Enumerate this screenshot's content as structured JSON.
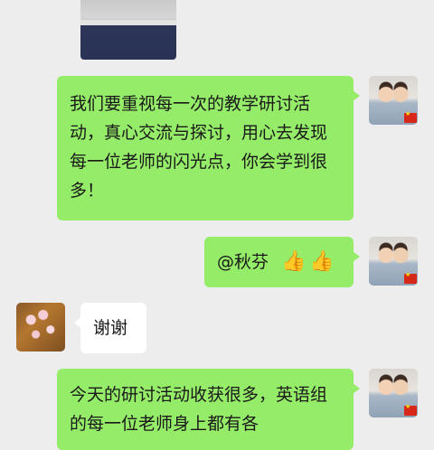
{
  "messages": [
    {
      "side": "me",
      "type": "image",
      "avatar": "avatar-kids"
    },
    {
      "side": "me",
      "type": "text",
      "text": "我们要重视每一次的教学研讨活动，真心交流与探讨，用心去发现每一位老师的闪光点，你会学到很多！"
    },
    {
      "side": "me",
      "type": "text",
      "mention": "@秋芬",
      "emoji": [
        "👍",
        "👍"
      ]
    },
    {
      "side": "other",
      "type": "text",
      "text": "谢谢"
    },
    {
      "side": "me",
      "type": "text",
      "text": "今天的研讨活动收获很多，英语组的每一位老师身上都有各"
    }
  ],
  "icons": {
    "my_avatar": "avatar-kids-photo",
    "other_avatar": "avatar-plum-blossom",
    "flag": "china-flag",
    "thumbs_up": "thumbs-up-emoji"
  },
  "colors": {
    "background": "#ededed",
    "sent_bubble": "#95ec69",
    "received_bubble": "#ffffff",
    "text": "#191919"
  }
}
